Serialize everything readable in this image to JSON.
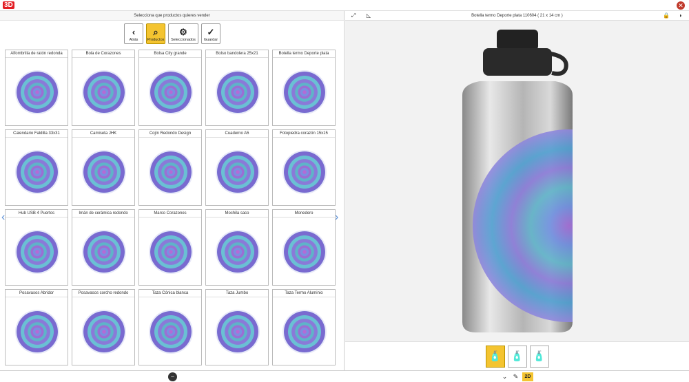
{
  "app": {
    "logo": "3D",
    "close_glyph": "✕"
  },
  "left": {
    "header": "Selecciona que productos quieres vender"
  },
  "toolbar": [
    {
      "label": "Atrás",
      "icon": "‹",
      "name": "back-button",
      "active": false
    },
    {
      "label": "Productos",
      "icon": "⌕",
      "name": "products-button",
      "active": true
    },
    {
      "label": "Seleccionados",
      "icon": "⚙",
      "name": "selected-button",
      "active": false
    },
    {
      "label": "Guardar",
      "icon": "✓",
      "name": "save-button",
      "active": false
    }
  ],
  "products": [
    "Alfombrilla de ratón redonda",
    "Bola de Corazones",
    "Bolsa City grande",
    "Bolso bandolera 25x21",
    "Botella termo Deporte plata",
    "Calendario Faldilla 33x31",
    "Camiseta JHK",
    "Cojín Redondo Design",
    "Cuaderno A5",
    "Fotopiedra corazón 15x15",
    "Hub USB 4 Puertos",
    "Imán de cerámica redondo",
    "Marco Corazones",
    "Mochila saco",
    "Monedero",
    "Posavasos Abridor",
    "Posavasos corcho redondo",
    "Taza Cónica blanca",
    "Taza Jumbo",
    "Taza Termo Aluminio"
  ],
  "right": {
    "header": "Botella termo Deporte plata 110604 ( 21 x 14 cm )"
  },
  "nav": {
    "prev": "‹",
    "next": "›"
  },
  "bottom": {
    "mode": "2D",
    "minus": "−",
    "chevron": "⌄",
    "pencil": "✎"
  },
  "colors": {
    "accent": "#f4c430",
    "close": "#c0392b"
  }
}
